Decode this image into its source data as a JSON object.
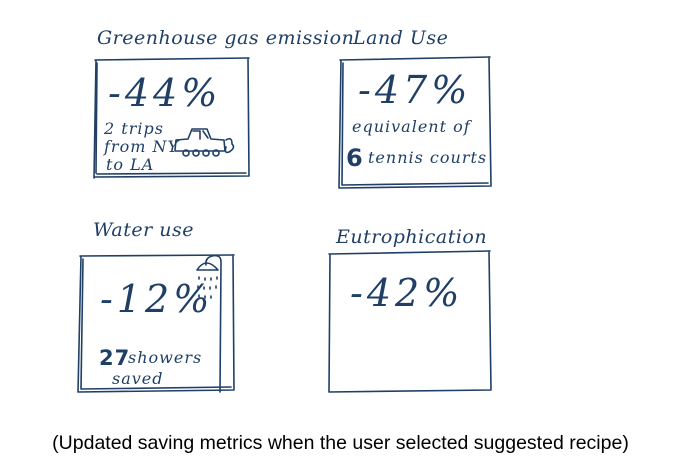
{
  "colors": {
    "ink": "#1f3f66",
    "caption": "#000000",
    "background": "#ffffff"
  },
  "cards": [
    {
      "title": "Greenhouse gas emission",
      "value": "-44%",
      "note_lines": [
        "2 trips",
        "from NY",
        "to LA"
      ],
      "icon": "car-icon"
    },
    {
      "title": "Land Use",
      "value": "-47%",
      "note_lines": [
        "equivalent of"
      ],
      "highlight_number": "6",
      "highlight_suffix": "tennis courts"
    },
    {
      "title": "Water use",
      "value": "-12%",
      "highlight_number": "27",
      "highlight_suffix": "showers",
      "note_lines": [
        "saved"
      ],
      "icon": "shower-icon"
    },
    {
      "title": "Eutrophication",
      "value": "-42%"
    }
  ],
  "caption": "(Updated saving metrics when the user selected suggested recipe)"
}
